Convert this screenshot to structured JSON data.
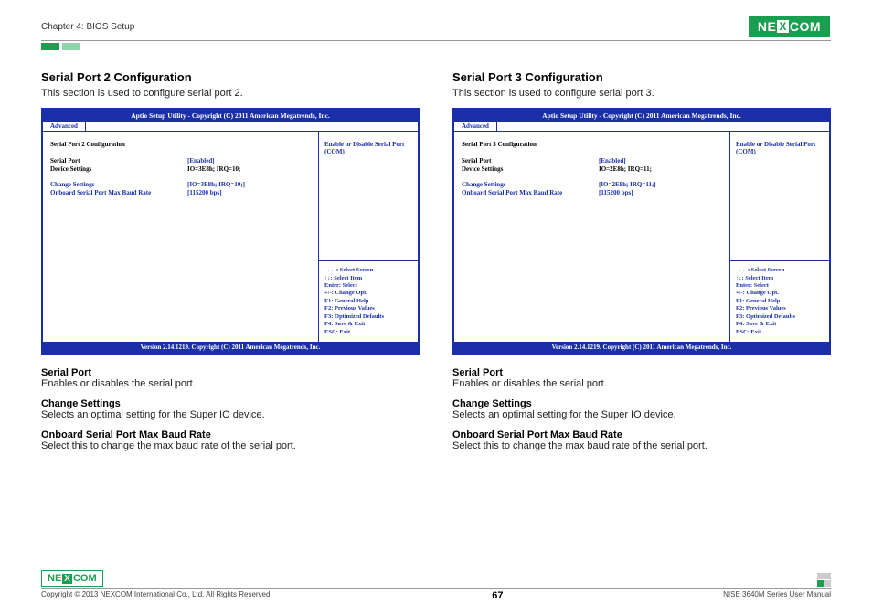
{
  "header": {
    "chapter": "Chapter 4: BIOS Setup",
    "logo_left": "NE",
    "logo_mid": "X",
    "logo_right": "COM"
  },
  "left": {
    "heading": "Serial Port 2 Configuration",
    "desc": "This section is used to configure serial port 2.",
    "bios": {
      "title": "Aptio Setup Utility - Copyright (C) 2011 American Megatrends, Inc.",
      "tab": "Advanced",
      "config_title": "Serial Port 2 Configuration",
      "rows": {
        "serial_port_label": "Serial Port",
        "serial_port_value": "[Enabled]",
        "device_label": "Device Settings",
        "device_value": "IO=3E8h; IRQ=10;",
        "change_label": "Change Settings",
        "change_value": "[IO=3E8h; IRQ=10;]",
        "baud_label": "Onboard Serial Port Max Baud Rate",
        "baud_value": "[115200 bps]"
      },
      "help": "Enable or Disable Serial Port (COM)",
      "keys": {
        "k1": "→←: Select Screen",
        "k2": "↑↓: Select Item",
        "k3": "Enter: Select",
        "k4": "+/-: Change Opt.",
        "k5": "F1: General Help",
        "k6": "F2: Previous Values",
        "k7": "F3: Optimized Defaults",
        "k8": "F4: Save & Exit",
        "k9": "ESC: Exit"
      },
      "footer": "Version 2.14.1219. Copyright (C) 2011 American Megatrends, Inc."
    },
    "descs": {
      "t1": "Serial Port",
      "d1": "Enables or disables the serial port.",
      "t2": "Change Settings",
      "d2": "Selects an optimal setting for the Super IO device.",
      "t3": "Onboard Serial Port Max Baud Rate",
      "d3": "Select this to change the max baud rate of the serial port."
    }
  },
  "right": {
    "heading": "Serial Port 3 Configuration",
    "desc": "This section is used to configure serial port 3.",
    "bios": {
      "title": "Aptio Setup Utility - Copyright (C) 2011 American Megatrends, Inc.",
      "tab": "Advanced",
      "config_title": "Serial Port 3 Configuration",
      "rows": {
        "serial_port_label": "Serial Port",
        "serial_port_value": "[Enabled]",
        "device_label": "Device Settings",
        "device_value": "IO=2E8h; IRQ=11;",
        "change_label": "Change Settings",
        "change_value": "[IO=2E8h; IRQ=11;]",
        "baud_label": "Onboard Serial Port Max Baud Rate",
        "baud_value": "[115200 bps]"
      },
      "help": "Enable or Disable Serial Port (COM)",
      "keys": {
        "k1": "→←: Select Screen",
        "k2": "↑↓: Select Item",
        "k3": "Enter: Select",
        "k4": "+/-: Change Opt.",
        "k5": "F1: General Help",
        "k6": "F2: Previous Values",
        "k7": "F3: Optimized Defaults",
        "k8": "F4: Save & Exit",
        "k9": "ESC: Exit"
      },
      "footer": "Version 2.14.1219. Copyright (C) 2011 American Megatrends, Inc."
    },
    "descs": {
      "t1": "Serial Port",
      "d1": "Enables or disables the serial port.",
      "t2": "Change Settings",
      "d2": "Selects an optimal setting for the Super IO device.",
      "t3": "Onboard Serial Port Max Baud Rate",
      "d3": "Select this to change the max baud rate of the serial port."
    }
  },
  "footer": {
    "copyright": "Copyright © 2013 NEXCOM International Co., Ltd. All Rights Reserved.",
    "page": "67",
    "manual": "NISE 3640M Series User Manual"
  }
}
